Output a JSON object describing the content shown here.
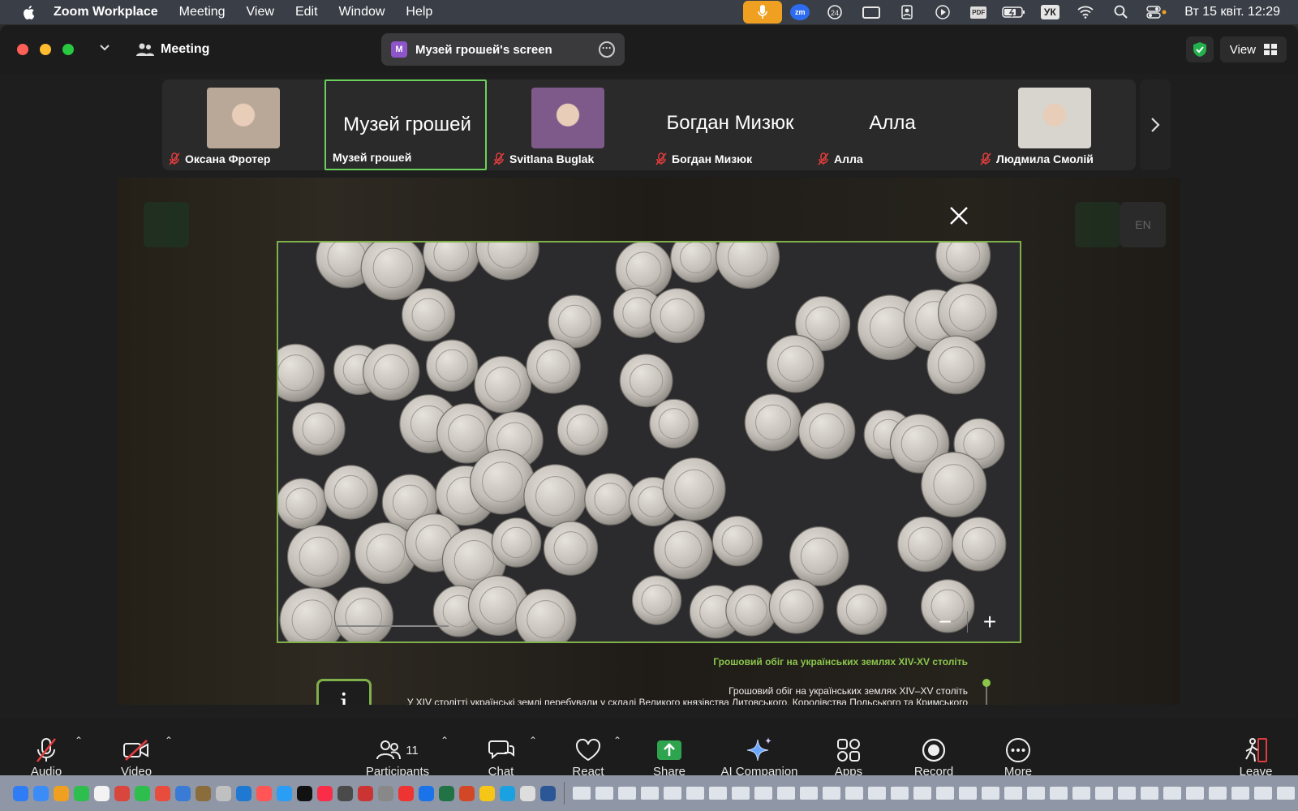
{
  "menubar": {
    "app": "Zoom Workplace",
    "items": [
      "Meeting",
      "View",
      "Edit",
      "Window",
      "Help"
    ],
    "tray": {
      "keyboard": "УК",
      "pdf": "PDF",
      "zm": "zm",
      "badge": "24"
    },
    "clock": "Вт 15 квіт.  12:29"
  },
  "window": {
    "meeting_label": "Meeting",
    "screen_title": "Музей грошей's screen",
    "screen_initial": "M",
    "view_label": "View"
  },
  "participants": [
    {
      "name": "Оксана Фротер",
      "display": "",
      "has_photo": true,
      "photo_color": "#b9a898",
      "active": false
    },
    {
      "name": "Музей грошей",
      "display": "Музей грошей",
      "has_photo": false,
      "active": true
    },
    {
      "name": "Svitlana Buglak",
      "display": "",
      "has_photo": true,
      "photo_color": "#7d5a8a",
      "active": false
    },
    {
      "name": "Богдан Мизюк",
      "display": "Богдан Мизюк",
      "has_photo": false,
      "active": false
    },
    {
      "name": "Алла",
      "display": "Алла",
      "has_photo": false,
      "active": false
    },
    {
      "name": "Людмила Смолій",
      "display": "",
      "has_photo": true,
      "photo_color": "#d8d4ce",
      "active": false
    }
  ],
  "shared": {
    "lang": "EN",
    "caption_title": "Грошовий обіг на українських землях XIV-XV століть",
    "info_glyph": "i",
    "para_title": "Грошовий обіг на українських землях XIV–XV століть",
    "para_line": "У XIV столітті українські землі перебували у складі Великого князівства Литовського, Королівства Польського та Кримського",
    "zoom_minus": "−",
    "zoom_plus": "+"
  },
  "toolbar": {
    "audio": "Audio",
    "video": "Video",
    "participants": "Participants",
    "participants_count": "11",
    "chat": "Chat",
    "react": "React",
    "share": "Share",
    "ai": "AI Companion",
    "apps": "Apps",
    "record": "Record",
    "more": "More",
    "leave": "Leave"
  },
  "colors": {
    "accent_green": "#6bd15c",
    "share_green": "#2ea44f",
    "mic_orange": "#f0a020"
  }
}
